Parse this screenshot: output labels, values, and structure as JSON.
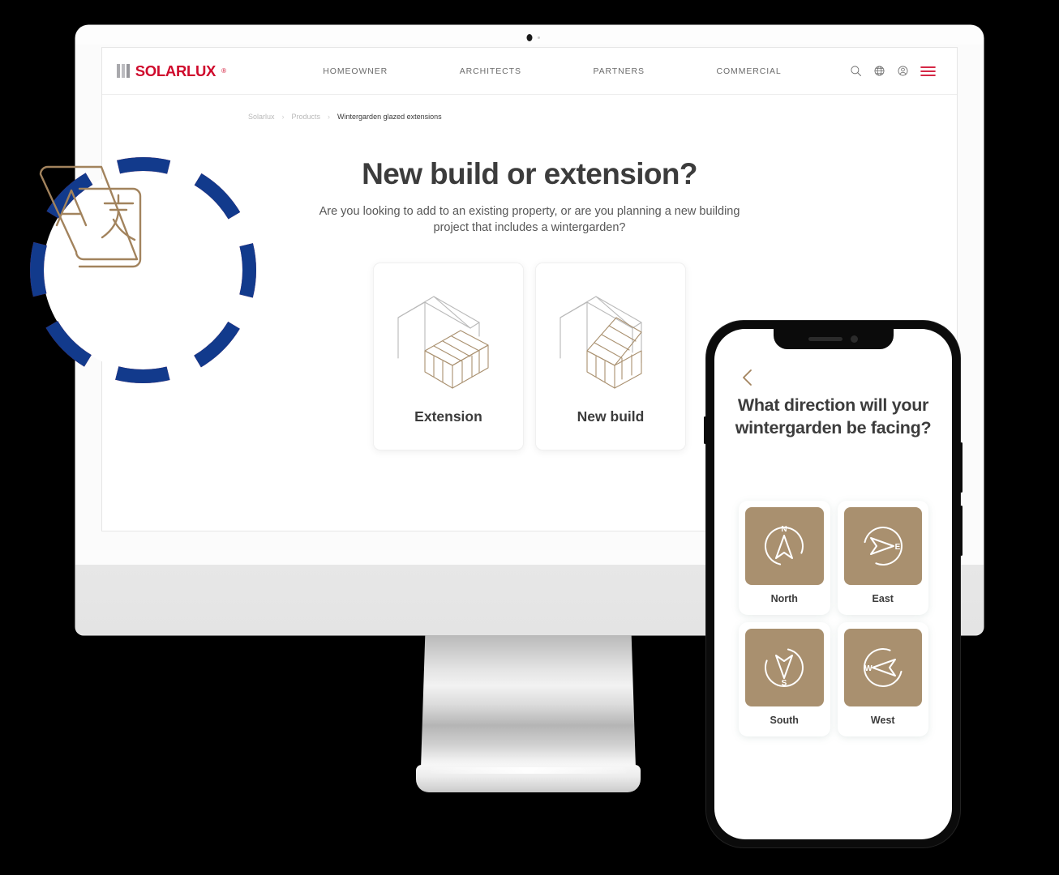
{
  "colors": {
    "brand_red": "#cf0a2c",
    "badge_red": "#d81e3c",
    "badge_blue": "#123a8c",
    "tan": "#a9906f",
    "text_dark": "#3c3c3c",
    "text_muted": "#6b6b6b"
  },
  "site": {
    "logo_word": "SOLARLUX",
    "logo_reg": "®",
    "nav_links": [
      {
        "label": "HOMEOWNER"
      },
      {
        "label": "ARCHITECTS"
      },
      {
        "label": "PARTNERS"
      },
      {
        "label": "COMMERCIAL"
      }
    ],
    "nav_icons": [
      {
        "name": "search-icon"
      },
      {
        "name": "globe-icon"
      },
      {
        "name": "account-icon"
      },
      {
        "name": "hamburger-menu-icon"
      }
    ]
  },
  "breadcrumb": {
    "items": [
      {
        "label": "Solarlux"
      },
      {
        "label": "Products"
      },
      {
        "label": "Wintergarden glazed extensions"
      }
    ],
    "separator": "›"
  },
  "hero": {
    "title": "New build or extension?",
    "subtitle": "Are you looking to add to an existing property, or are you planning a new building project that includes a wintergarden?"
  },
  "cards": [
    {
      "label": "Extension",
      "art": "house-with-side-extension-illustration"
    },
    {
      "label": "New build",
      "art": "house-with-integrated-wintergarden-illustration"
    }
  ],
  "badge": {
    "icon": "translate-icon",
    "glyph_latin": "A",
    "glyph_cjk": "文",
    "ring_segments": 8
  },
  "phone": {
    "back_icon": "back-chevron-icon",
    "title": "What direction will your wintergarden be facing?",
    "directions": [
      {
        "label": "North",
        "letter": "N",
        "icon": "compass-north-icon"
      },
      {
        "label": "East",
        "letter": "E",
        "icon": "compass-east-icon"
      },
      {
        "label": "South",
        "letter": "S",
        "icon": "compass-south-icon"
      },
      {
        "label": "West",
        "letter": "W",
        "icon": "compass-west-icon"
      }
    ]
  }
}
